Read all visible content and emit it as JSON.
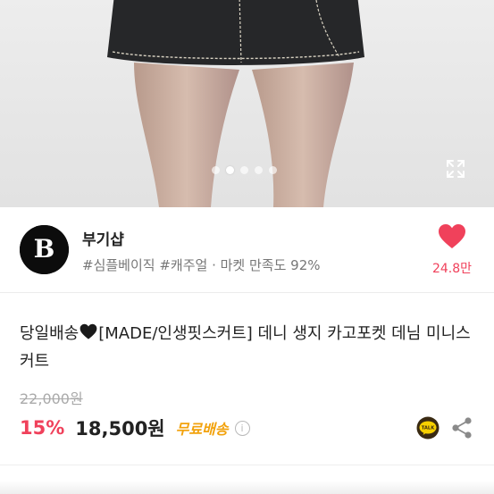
{
  "hero": {
    "image_desc": "product-photo",
    "slide_count": 5,
    "active_slide": 1
  },
  "shop": {
    "name": "부기샵",
    "logo_letter": "B",
    "tags": "#심플베이직 #캐주얼",
    "sep": " · ",
    "satisfaction": "마켓 만족도 92%",
    "likes": "24.8만"
  },
  "product": {
    "title_part1": "당일배송",
    "title_part2": "[MADE/인생핏스커트] 데니 생지 카고포켓 데님 미니스커트",
    "original_price": "22,000원",
    "discount": "15%",
    "price": "18,500원",
    "shipping": "무료배송",
    "info_glyph": "i",
    "talk_label": "TALK"
  },
  "colors": {
    "accent": "#f0415b",
    "shipping": "#f2a20c",
    "muted": "#777777"
  }
}
